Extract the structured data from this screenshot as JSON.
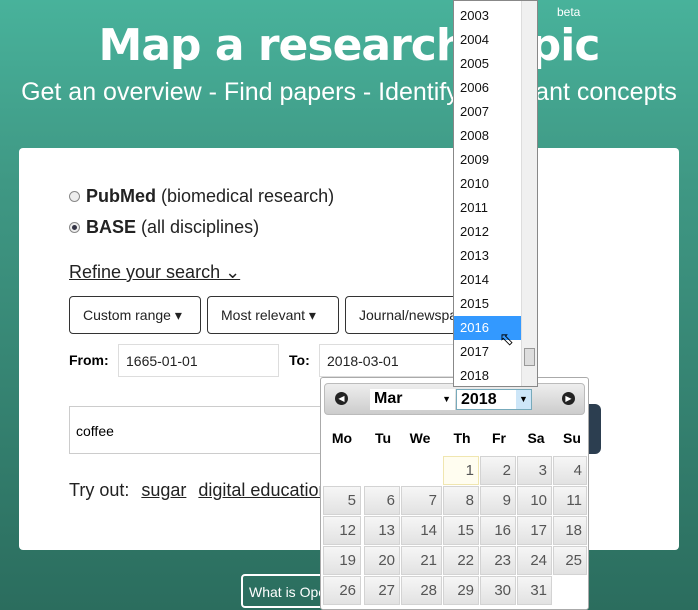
{
  "header": {
    "title": "Map a research topic",
    "beta": "beta",
    "subtitle": "Get an overview - Find papers - Identify important concepts"
  },
  "sources": [
    {
      "name": "PubMed",
      "desc": "(biomedical research)",
      "selected": false
    },
    {
      "name": "BASE",
      "desc": "(all disciplines)",
      "selected": true
    }
  ],
  "refine_label": "Refine your search ⌄",
  "filters": [
    "Custom range ▾",
    "Most relevant ▾",
    "Journal/newspaper"
  ],
  "from_label": "From:",
  "from_value": "1665-01-01",
  "to_label": "To:",
  "to_value": "2018-03-01",
  "query": "coffee",
  "try_out": {
    "label": "Try out:",
    "links": [
      "sugar",
      "digital education"
    ]
  },
  "what_is": "What is Open Knowledge Maps?",
  "year_list": {
    "items": [
      "2003",
      "2004",
      "2005",
      "2006",
      "2007",
      "2008",
      "2009",
      "2010",
      "2011",
      "2012",
      "2013",
      "2014",
      "2015",
      "2016",
      "2017",
      "2018"
    ],
    "highlighted": "2016"
  },
  "datepicker": {
    "month": "Mar",
    "year": "2018",
    "weekdays": [
      "Mo",
      "Tu",
      "We",
      "Th",
      "Fr",
      "Sa",
      "Su"
    ],
    "first_weekday_index": 3,
    "days": 31,
    "today": 1
  }
}
